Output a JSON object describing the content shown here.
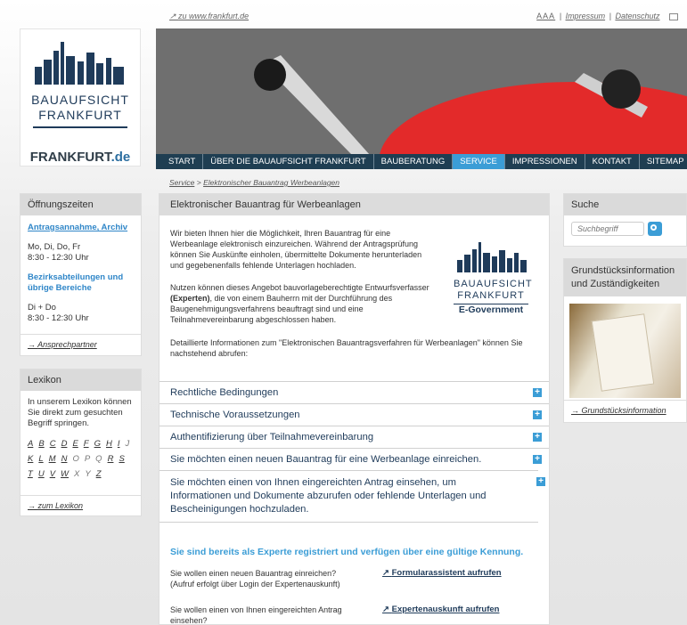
{
  "top": {
    "ffm_link": "zu www.frankfurt.de",
    "font_size": "AAA",
    "impressum": "Impressum",
    "datenschutz": "Datenschutz"
  },
  "logo": {
    "line1": "BAUAUFSICHT",
    "line2": "FRANKFURT"
  },
  "frankfurt_de": {
    "main": "FRANKFURT",
    "suffix": ".de"
  },
  "nav": {
    "items": [
      "START",
      "ÜBER DIE BAUAUFSICHT FRANKFURT",
      "BAUBERATUNG",
      "SERVICE",
      "IMPRESSIONEN",
      "KONTAKT"
    ],
    "sitemap": "SITEMAP",
    "active_index": 3
  },
  "breadcrumb": {
    "item1": "Service",
    "sep": ">",
    "item2": "Elektronischer Bauantrag Werbeanlagen"
  },
  "oeffnungszeiten": {
    "title": "Öffnungszeiten",
    "sub1": "Antragsannahme, Archiv",
    "days1": "Mo, Di, Do, Fr",
    "time1": "8:30 - 12:30 Uhr",
    "sub2a": "Bezirksabteilungen und",
    "sub2b": "übrige Bereiche",
    "days2": "Di + Do",
    "time2": "8:30 - 12:30 Uhr",
    "link": "Ansprechpartner"
  },
  "lexikon": {
    "title": "Lexikon",
    "text": "In unserem Lexikon können Sie direkt zum gesuchten Begriff springen.",
    "rows": [
      [
        "A",
        "B",
        "C",
        "D",
        "E",
        "F",
        "G",
        "H",
        "I",
        "J"
      ],
      [
        "K",
        "L",
        "M",
        "N",
        "O",
        "P",
        "Q",
        "R",
        "S"
      ],
      [
        "T",
        "U",
        "V",
        "W",
        "X",
        "Y",
        "Z"
      ]
    ],
    "link": "zum Lexikon"
  },
  "content": {
    "title": "Elektronischer Bauantrag für Werbeanlagen",
    "p1": "Wir bieten Ihnen hier die Möglichkeit, Ihren Bauantrag für eine Werbeanlage elektronisch einzureichen. Während der Antragsprüfung können Sie Auskünfte einholen, übermittelte Dokumente herunterladen und gegebenenfalls fehlende Unterlagen hochladen.",
    "p2_pre": "Nutzen können dieses Angebot bauvorlageberechtigte Entwurfsverfasser",
    "p2_bold": "(Experten)",
    "p2_post": ", die von einem Bauherrn mit der Durchführung des Baugenehmigungsverfahrens beauftragt sind und eine Teilnahmevereinbarung abgeschlossen haben.",
    "p3": "Detaillierte Informationen zum \"Elektronischen Bauantragsverfahren für Werbeanlagen\" können Sie nachstehend abrufen:",
    "egov_logo": {
      "line1": "BAUAUFSICHT",
      "line2": "FRANKFURT",
      "line3": "E-Government"
    },
    "accordion": [
      "Rechtliche Bedingungen",
      "Technische Voraussetzungen",
      "Authentifizierung über Teilnahmevereinbarung",
      "Sie möchten einen neuen Bauantrag für eine Werbeanlage einreichen.",
      "Sie möchten einen von Ihnen eingereichten Antrag einsehen, um Informationen und Dokumente abzurufen oder fehlende Unterlagen und Bescheinigungen hochzuladen."
    ],
    "expert_heading": "Sie sind bereits als Experte registriert und verfügen über eine gültige Kennung.",
    "q1a": "Sie wollen einen neuen Bauantrag einreichen?",
    "q1b": "(Aufruf erfolgt über Login der Expertenauskunft)",
    "q1_link": "Formularassistent aufrufen",
    "q2a": "Sie wollen einen von Ihnen eingereichten Antrag",
    "q2b": "einsehen?",
    "q2_link": "Expertenauskunft aufrufen"
  },
  "suche": {
    "title": "Suche",
    "placeholder": "Suchbegriff"
  },
  "grund": {
    "title": "Grundstücksinformation und Zuständigkeiten",
    "link": "Grundstücksinformation"
  },
  "colors": {
    "navy": "#1f3e52",
    "accent": "#3b9dd6",
    "link_blue": "#2f86c8"
  }
}
